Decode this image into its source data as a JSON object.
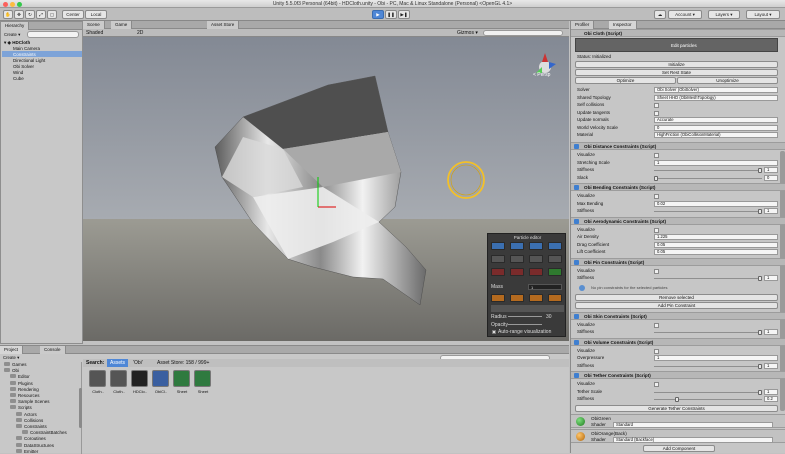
{
  "window": {
    "title": "Unity 5.5.0f3 Personal (64bit) - HDCloth.unity - Obi - PC, Mac & Linux Standalone (Personal) <OpenGL 4.1>"
  },
  "toolbar": {
    "center": "Center",
    "local": "Local",
    "play_icon": "▶",
    "pause_icon": "❚❚",
    "step_icon": "▶❚",
    "account": "Account ▾",
    "layers": "Layers ▾",
    "layout": "Layout ▾",
    "collab": "☁"
  },
  "hierarchy": {
    "tab": "Hierarchy",
    "create": "Create ▾",
    "scene": "HDCloth",
    "items": [
      "Main Camera",
      "Constraints",
      "Directional Light",
      "Obi Solver",
      "Wind",
      "Cube"
    ]
  },
  "scene": {
    "tab_scene": "Scene",
    "tab_game": "Game",
    "tab_store": "Asset Store",
    "shaded": "Shaded",
    "mode": "2D",
    "gizmos": "Gizmos ▾",
    "persp": "< Persp"
  },
  "particle_editor": {
    "title": "Particle editor",
    "mass": "Mass",
    "mass_value": "1",
    "radius": "Radius",
    "radius_value": "30",
    "opacity": "Opacity",
    "autorange": "Auto-range visualization"
  },
  "inspector": {
    "tab_profiler": "Profiler",
    "tab_inspector": "Inspector",
    "cloth_header": "Obi Cloth (Script)",
    "edit_particles": "Edit particles",
    "status": "Status: Initialized",
    "initialize": "Initialize",
    "set_rest_state": "Set Rest State",
    "optimize": "Optimize",
    "unoptimize": "Unoptimize",
    "props": [
      {
        "label": "Solver",
        "value": "Obi Solver (ObiSolver)"
      },
      {
        "label": "Shared Topology",
        "value": "Sheet HHD (ObiMeshTopology)"
      },
      {
        "label": "Self collisions",
        "value": ""
      },
      {
        "label": "Update tangents",
        "value": ""
      },
      {
        "label": "Update normals",
        "value": "Accurate"
      },
      {
        "label": "World Velocity Scale",
        "value": "0"
      },
      {
        "label": "Material",
        "value": "HighFriction (ObiCollisionMaterial)"
      }
    ],
    "sections": [
      {
        "header": "Obi Distance Constraints (Script)",
        "rows": [
          {
            "label": "Visualize",
            "value": ""
          },
          {
            "label": "Stretching Scale",
            "value": "1"
          },
          {
            "label": "Stiffness",
            "value": "1"
          },
          {
            "label": "Slack",
            "value": "0"
          }
        ]
      },
      {
        "header": "Obi Bending Constraints (Script)",
        "rows": [
          {
            "label": "Visualize",
            "value": ""
          },
          {
            "label": "Max Bending",
            "value": "0.02"
          },
          {
            "label": "Stiffness",
            "value": "1"
          }
        ]
      },
      {
        "header": "Obi Aerodynamic Constraints (Script)",
        "rows": [
          {
            "label": "Visualize",
            "value": ""
          },
          {
            "label": "Air Density",
            "value": "1.225"
          },
          {
            "label": "Drag Coefficient",
            "value": "0.05"
          },
          {
            "label": "Lift Coefficient",
            "value": "0.05"
          }
        ]
      },
      {
        "header": "Obi Pin Constraints (Script)",
        "rows": [
          {
            "label": "Visualize",
            "value": ""
          },
          {
            "label": "Stiffness",
            "value": "1"
          }
        ]
      }
    ],
    "pin_note": "No pin constraints for the selected particles",
    "remove_selected": "Remove selected",
    "add_pin": "Add Pin Constraint",
    "sections2": [
      {
        "header": "Obi Skin Constraints (Script)",
        "rows": [
          {
            "label": "Visualize",
            "value": ""
          },
          {
            "label": "Stiffness",
            "value": "1"
          }
        ]
      },
      {
        "header": "Obi Volume Constraints (Script)",
        "rows": [
          {
            "label": "Visualize",
            "value": ""
          },
          {
            "label": "Overpressure",
            "value": "1"
          },
          {
            "label": "Stiffness",
            "value": "1"
          }
        ]
      },
      {
        "header": "Obi Tether Constraints (Script)",
        "rows": [
          {
            "label": "Visualize",
            "value": ""
          },
          {
            "label": "Tether Scale",
            "value": "1"
          },
          {
            "label": "Stiffness",
            "value": "0.2"
          }
        ]
      }
    ],
    "generate_tether": "Generate Tether Constraints",
    "mat1": {
      "name": "ObiGreen",
      "shader_label": "Shader",
      "shader": "Standard"
    },
    "mat2": {
      "name": "ObiOrange(Back)",
      "shader_label": "Shader",
      "shader": "Standard (Backface)"
    },
    "add_component": "Add Component"
  },
  "project": {
    "tab_project": "Project",
    "tab_console": "Console",
    "create": "Create ▾",
    "search": "Search:",
    "scope_assets": "Assets",
    "scope_obi": "'Obi'",
    "scope_store": "Asset Store: 158 / 999+",
    "folders": [
      "Games",
      "Obi",
      "Editor",
      "Plugins",
      "Rendering",
      "Resources",
      "Sample Scenes",
      "Scripts",
      "Actors",
      "Collisions",
      "Constraints",
      "ConstraintBatches",
      "Coroutines",
      "DataStructures",
      "Emitter"
    ],
    "assets": [
      "Cloth..",
      "Cloth..",
      "HDClo..",
      "ObiCl..",
      "Sheet",
      "Sheet"
    ]
  },
  "colors": {
    "accent": "#4f87d6",
    "cloth": "#e6e6e6",
    "scene_bg": "#5a5d64"
  }
}
